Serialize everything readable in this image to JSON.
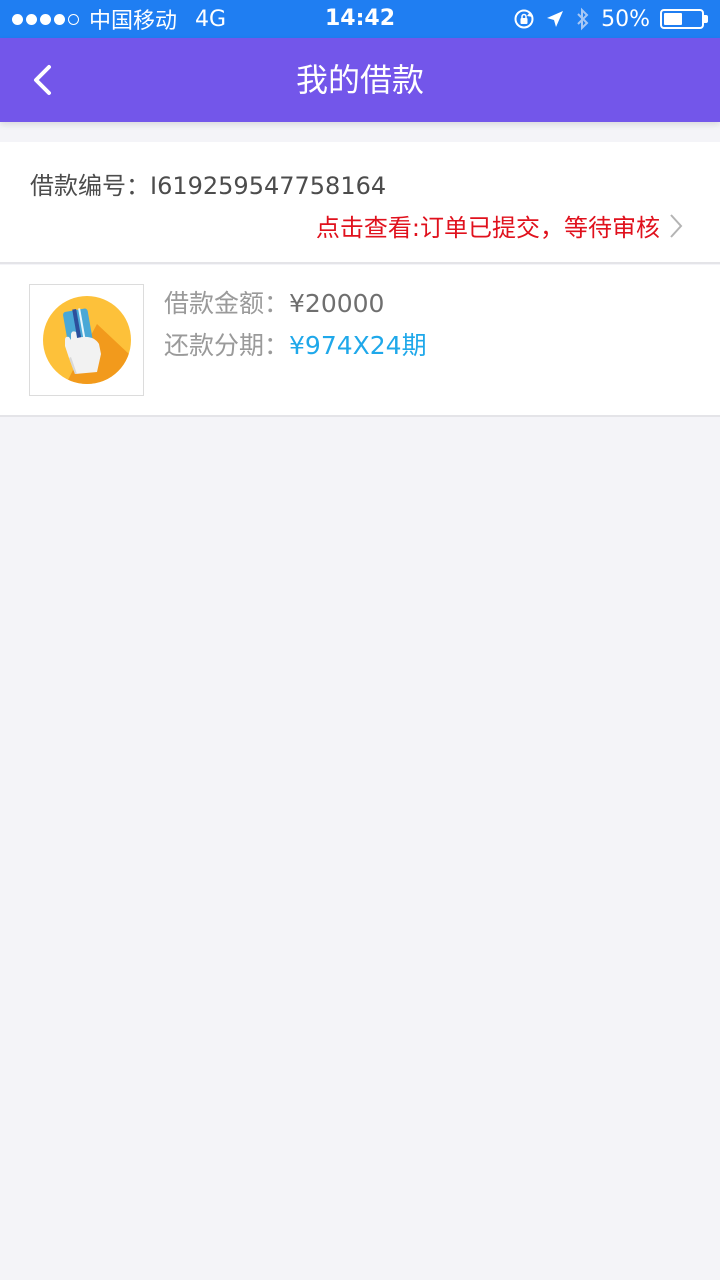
{
  "status_bar": {
    "carrier": "中国移动",
    "network": "4G",
    "time": "14:42",
    "battery": "50%",
    "battery_level": 0.5
  },
  "nav": {
    "title": "我的借款",
    "back_icon": "chevron-left-icon"
  },
  "order": {
    "id_label": "借款编号：",
    "id_value": "I619259547758164",
    "status_text": "点击查看:订单已提交，等待审核"
  },
  "detail": {
    "amount_label": "借款金额：",
    "amount_value": "¥20000",
    "installment_label": "还款分期：",
    "installment_value": "¥974X24期",
    "icon": "card-in-hand-icon"
  },
  "colors": {
    "status_bar": "#1f7ef2",
    "nav_bar": "#7356ea",
    "status_red": "#e0111d",
    "installment_blue": "#1fa8ea",
    "background": "#f4f4f8"
  }
}
